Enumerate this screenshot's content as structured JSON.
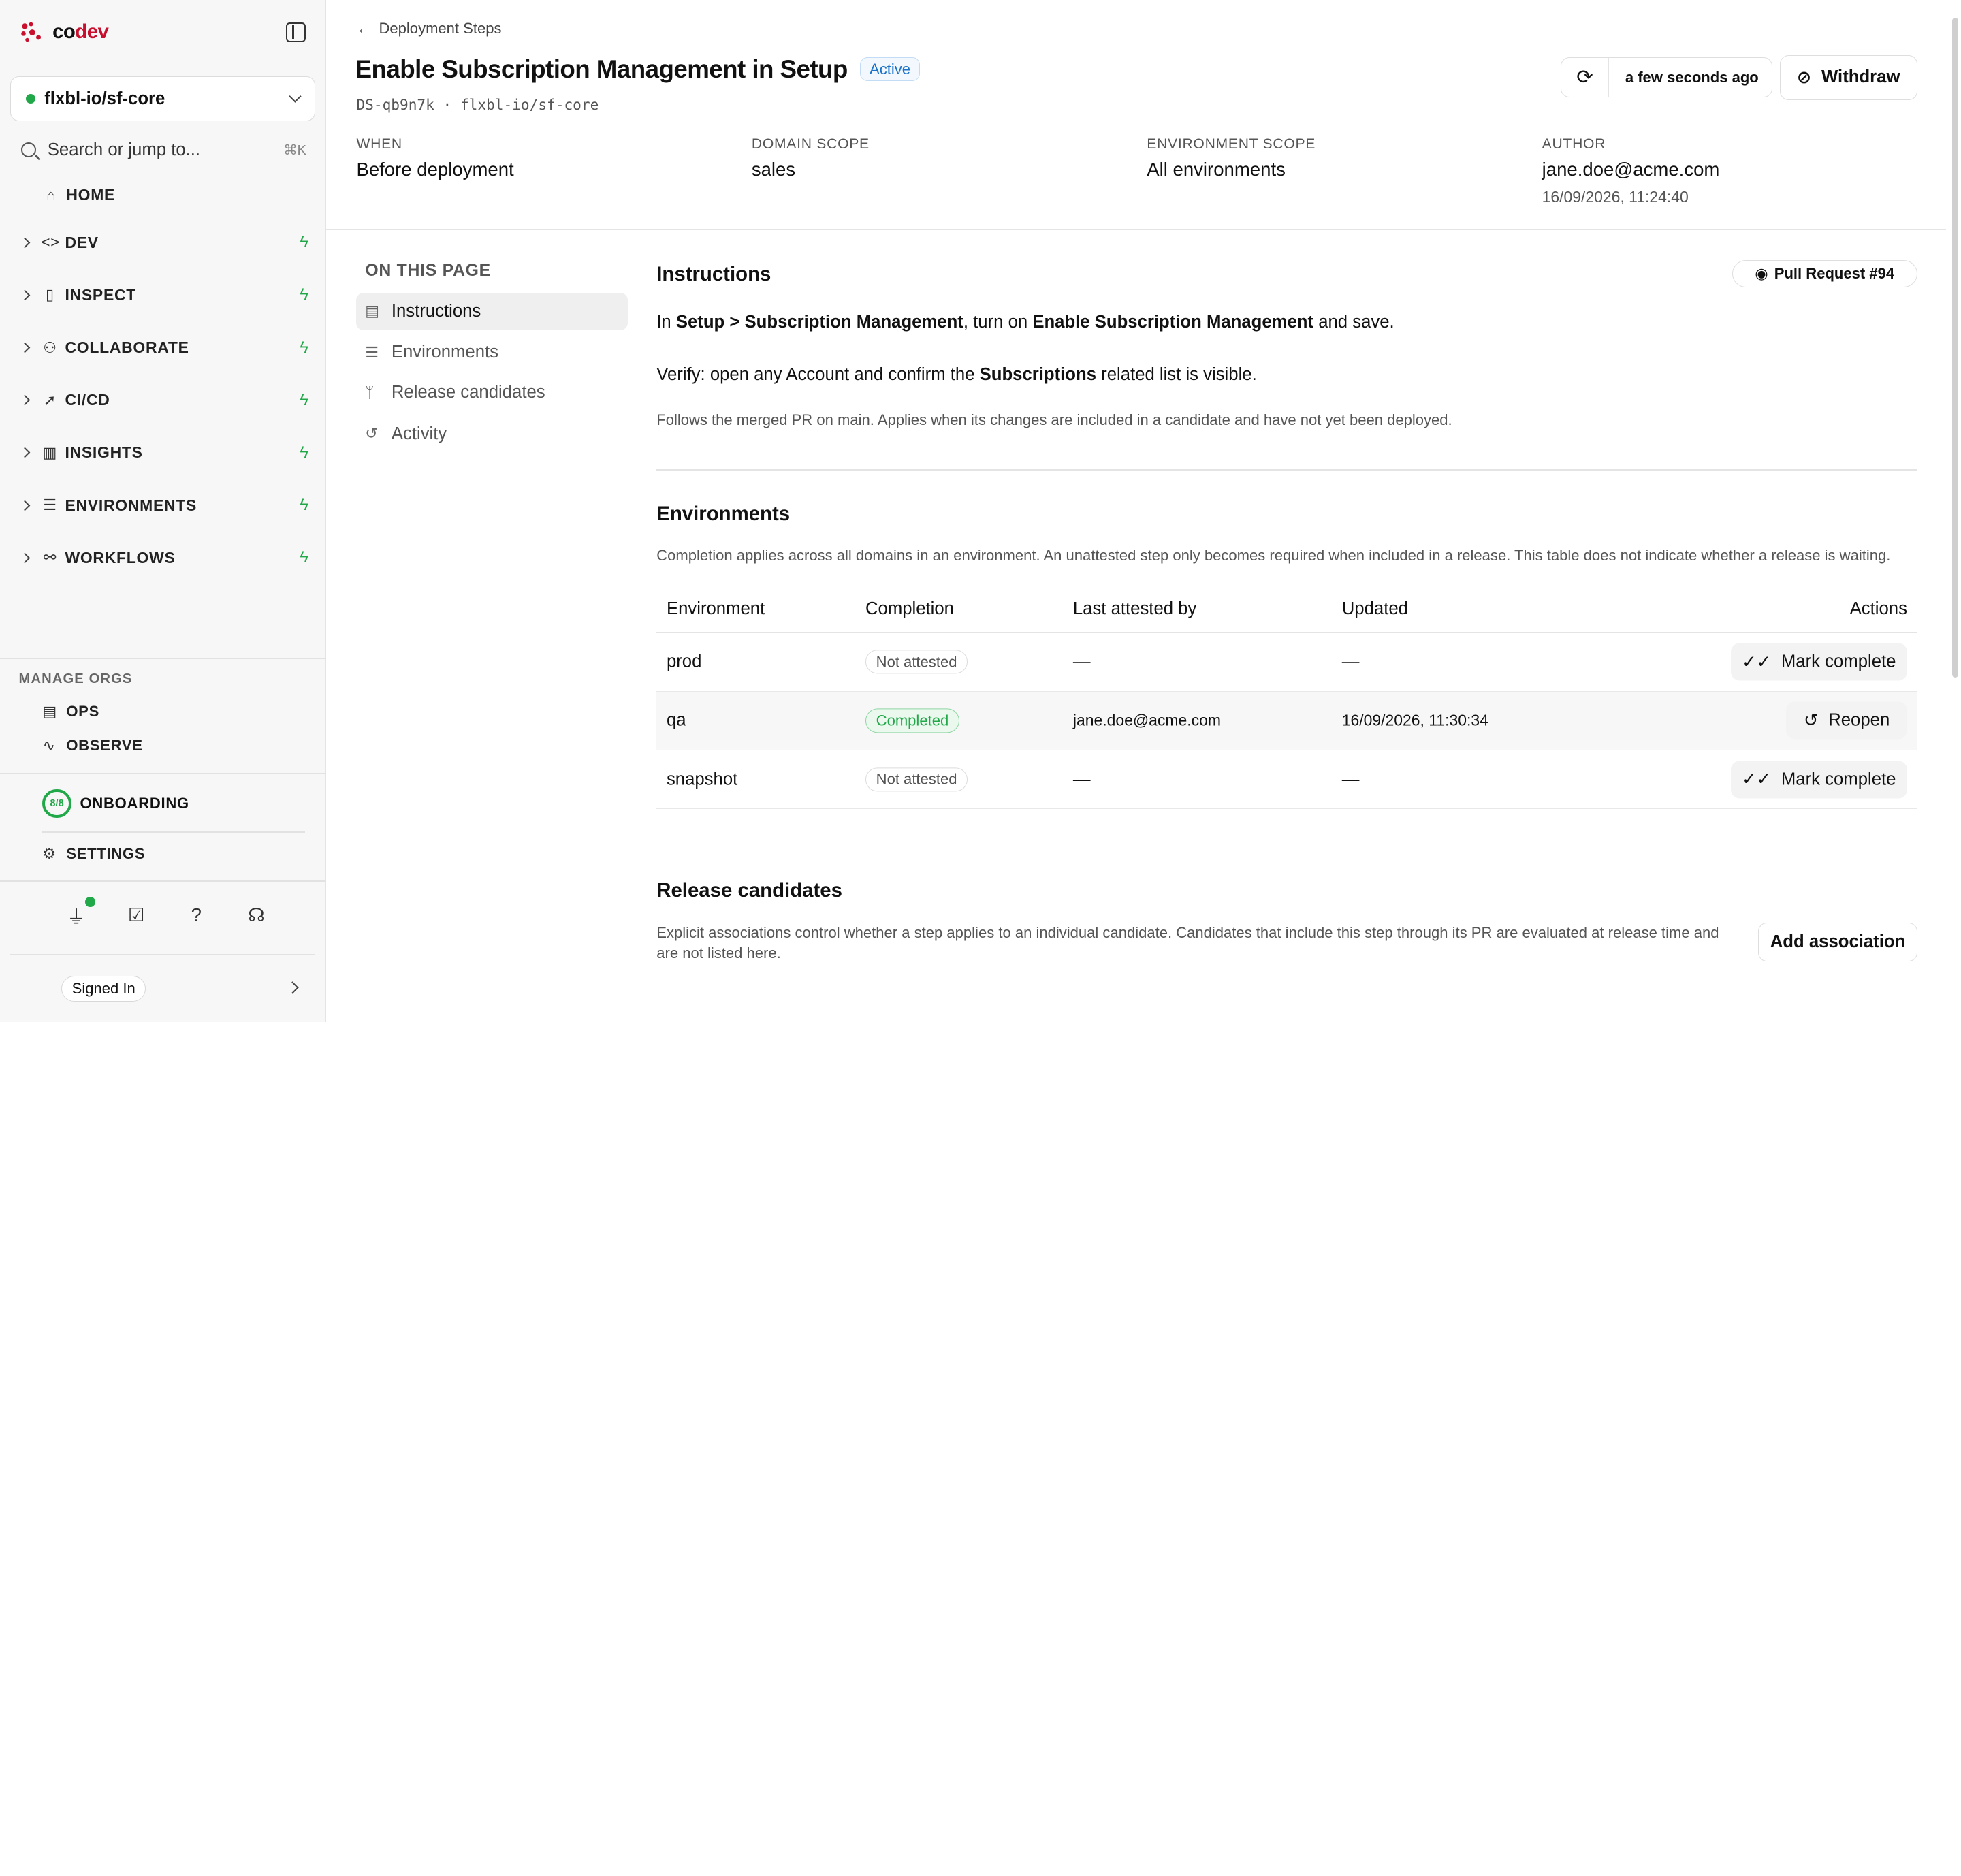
{
  "app": {
    "brand_prefix": "co",
    "brand_suffix": "dev"
  },
  "sidebar": {
    "org": "flxbl-io/sf-core",
    "search_placeholder": "Search or jump to...",
    "search_shortcut": "⌘K",
    "home": "HOME",
    "nav": [
      {
        "label": "DEV",
        "icon": "code-icon"
      },
      {
        "label": "INSPECT",
        "icon": "inspect-icon"
      },
      {
        "label": "COLLABORATE",
        "icon": "users-icon"
      },
      {
        "label": "CI/CD",
        "icon": "rocket-icon"
      },
      {
        "label": "INSIGHTS",
        "icon": "bar-chart-icon"
      },
      {
        "label": "ENVIRONMENTS",
        "icon": "server-icon"
      },
      {
        "label": "WORKFLOWS",
        "icon": "workflow-icon"
      }
    ],
    "manage_orgs_label": "MANAGE ORGS",
    "ops": "OPS",
    "observe": "OBSERVE",
    "onboarding": "ONBOARDING",
    "onboarding_progress": "8/8",
    "settings": "SETTINGS",
    "signed_in": "Signed In"
  },
  "header": {
    "back": "Deployment Steps",
    "title": "Enable Subscription Management in Setup",
    "status": "Active",
    "id_line": "DS-qb9n7k · flxbl-io/sf-core",
    "refresh_text": "a few seconds ago",
    "withdraw": "Withdraw",
    "meta": [
      {
        "key": "WHEN",
        "value": "Before deployment"
      },
      {
        "key": "DOMAIN SCOPE",
        "value": "sales"
      },
      {
        "key": "ENVIRONMENT SCOPE",
        "value": "All environments"
      },
      {
        "key": "AUTHOR",
        "value": "jane.doe@acme.com",
        "sub": "16/09/2026, 11:24:40"
      }
    ]
  },
  "toc": {
    "title": "ON THIS PAGE",
    "items": [
      "Instructions",
      "Environments",
      "Release candidates",
      "Activity"
    ]
  },
  "instructions": {
    "title": "Instructions",
    "pr_chip": "Pull Request #94",
    "line1": {
      "a": "In ",
      "b": "Setup > Subscription Management",
      "c": ", turn on ",
      "d": "Enable Subscription Management",
      "e": " and save."
    },
    "line2": {
      "a": "Verify: open any Account and confirm the ",
      "b": "Subscriptions",
      "c": " related list is visible."
    },
    "note": "Follows the merged PR on main. Applies when its changes are included in a candidate and have not yet been deployed."
  },
  "environments": {
    "title": "Environments",
    "note": "Completion applies across all domains in an environment. An unattested step only becomes required when included in a release. This table does not indicate whether a release is waiting.",
    "columns": [
      "Environment",
      "Completion",
      "Last attested by",
      "Updated",
      "Actions"
    ],
    "rows": [
      {
        "env": "prod",
        "completion": "Not attested",
        "by": "—",
        "updated": "—",
        "action": "Mark complete"
      },
      {
        "env": "qa",
        "completion": "Completed",
        "by": "jane.doe@acme.com",
        "updated": "16/09/2026, 11:30:34",
        "action": "Reopen"
      },
      {
        "env": "snapshot",
        "completion": "Not attested",
        "by": "—",
        "updated": "—",
        "action": "Mark complete"
      }
    ]
  },
  "release_candidates": {
    "title": "Release candidates",
    "note": "Explicit associations control whether a step applies to an individual candidate. Candidates that include this step through its PR are evaluated at release time and are not listed here.",
    "add": "Add association"
  },
  "colors": {
    "accent_green": "#21a848",
    "brand_red": "#c8102e",
    "active_blue": "#1a73c9"
  }
}
